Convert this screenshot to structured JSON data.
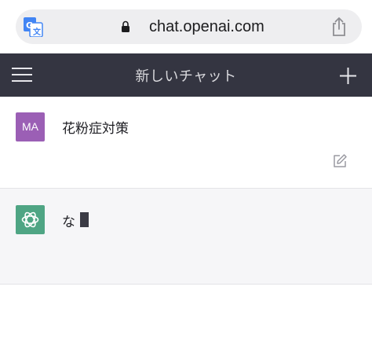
{
  "browser": {
    "url": "chat.openai.com"
  },
  "header": {
    "title": "新しいチャット"
  },
  "conversation": {
    "user_avatar_initials": "MA",
    "user_message": "花粉症対策",
    "assistant_message": "な"
  },
  "colors": {
    "nav_background": "#343541",
    "user_avatar": "#9b5fb5",
    "assistant_avatar": "#4fa584"
  },
  "icons": [
    "translate-icon",
    "lock-icon",
    "share-icon",
    "menu-icon",
    "plus-icon",
    "edit-icon",
    "openai-logo-icon"
  ]
}
